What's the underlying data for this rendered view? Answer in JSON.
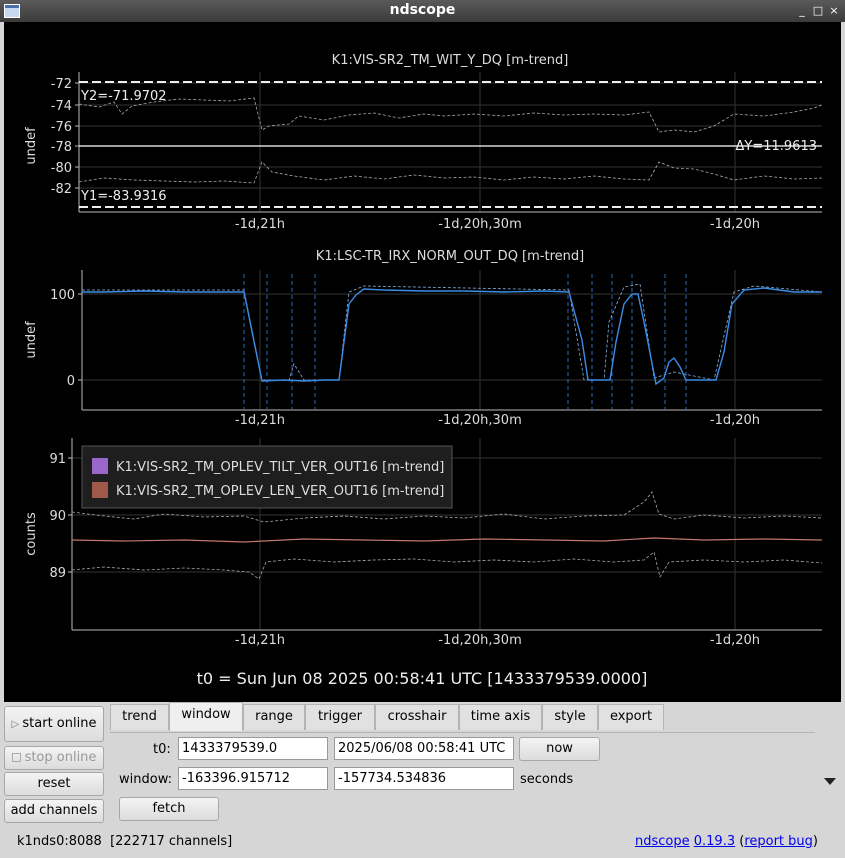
{
  "window": {
    "title": "ndscope",
    "controls": [
      "_",
      "□",
      "×"
    ]
  },
  "plots": [
    {
      "title": "K1:VIS-SR2_TM_WIT_Y_DQ [m-trend]",
      "ylabel": "undef",
      "yticks": [
        "-72",
        "-74",
        "-76",
        "-78",
        "-80",
        "-82"
      ],
      "xticks": [
        "-1d,21h",
        "-1d,20h,30m",
        "-1d,20h"
      ],
      "cursor_y2": "Y2=-71.9702",
      "cursor_y1": "Y1=-83.9316",
      "cursor_dy": "ΔY=11.9613",
      "line_color": "#ffffff"
    },
    {
      "title": "K1:LSC-TR_IRX_NORM_OUT_DQ [m-trend]",
      "ylabel": "undef",
      "yticks": [
        "100",
        "0"
      ],
      "xticks": [
        "-1d,21h",
        "-1d,20h,30m",
        "-1d,20h"
      ],
      "line_color": "#3a8ee6"
    },
    {
      "title": "",
      "ylabel": "counts",
      "yticks": [
        "91",
        "90",
        "89"
      ],
      "xticks": [
        "-1d,21h",
        "-1d,20h,30m",
        "-1d,20h"
      ],
      "legend": [
        {
          "name": "K1:VIS-SR2_TM_OPLEV_TILT_VER_OUT16 [m-trend]",
          "color": "#9966cc"
        },
        {
          "name": "K1:VIS-SR2_TM_OPLEV_LEN_VER_OUT16 [m-trend]",
          "color": "#a0584a"
        }
      ]
    }
  ],
  "t0_label": "t0 = Sun Jun 08 2025 00:58:41 UTC [1433379539.0000]",
  "controls": {
    "start_online": "start online",
    "stop_online": "stop online",
    "reset": "reset",
    "add_channels": "add channels",
    "tabs": [
      "trend",
      "window",
      "range",
      "trigger",
      "crosshair",
      "time axis",
      "style",
      "export"
    ],
    "active_tab": "window",
    "t0_label": "t0:",
    "t0_gps": "1433379539.0",
    "t0_utc": "2025/06/08 00:58:41 UTC",
    "now": "now",
    "window_label": "window:",
    "window_start": "-163396.915712",
    "window_end": "-157734.534836",
    "seconds": "seconds",
    "fetch": "fetch"
  },
  "status": {
    "server": "k1nds0:8088",
    "channels": "[222717 channels]",
    "app_name": "ndscope",
    "version": "0.19.3",
    "open_paren": "(",
    "report_bug": "report bug",
    "close_paren": ")"
  }
}
